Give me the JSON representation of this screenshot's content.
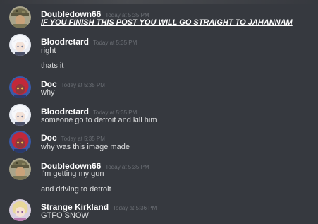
{
  "messages": [
    {
      "username": "Doubledown66",
      "timestamp": "Today at 5:35 PM",
      "avatar": "camo-hat-avatar",
      "lines": [
        "IF YOU FINISH THIS POST YOU WILL GO STRAIGHT TO JAHANNAM"
      ]
    },
    {
      "username": "Bloodretard",
      "timestamp": "Today at 5:35 PM",
      "avatar": "white-hair-anime-avatar",
      "lines": [
        "right",
        "thats it"
      ]
    },
    {
      "username": "Doc",
      "timestamp": "Today at 5:35 PM",
      "avatar": "red-hair-anime-avatar",
      "lines": [
        "why"
      ]
    },
    {
      "username": "Bloodretard",
      "timestamp": "Today at 5:35 PM",
      "avatar": "white-hair-anime-avatar",
      "lines": [
        "someone go to detroit and kill him"
      ]
    },
    {
      "username": "Doc",
      "timestamp": "Today at 5:35 PM",
      "avatar": "red-hair-anime-avatar",
      "lines": [
        "why was this image made"
      ]
    },
    {
      "username": "Doubledown66",
      "timestamp": "Today at 5:35 PM",
      "avatar": "camo-hat-avatar",
      "lines": [
        "I'm getting my gun",
        "and driving to detroit"
      ]
    },
    {
      "username": "Strange Kirkland",
      "timestamp": "Today at 5:36 PM",
      "avatar": "blonde-anime-avatar",
      "lines": [
        "GTFO SNOW"
      ]
    }
  ],
  "colors": {
    "background": "#36393f",
    "username": "#ffffff",
    "timestamp": "#6b6f75",
    "text": "#dcddde"
  }
}
